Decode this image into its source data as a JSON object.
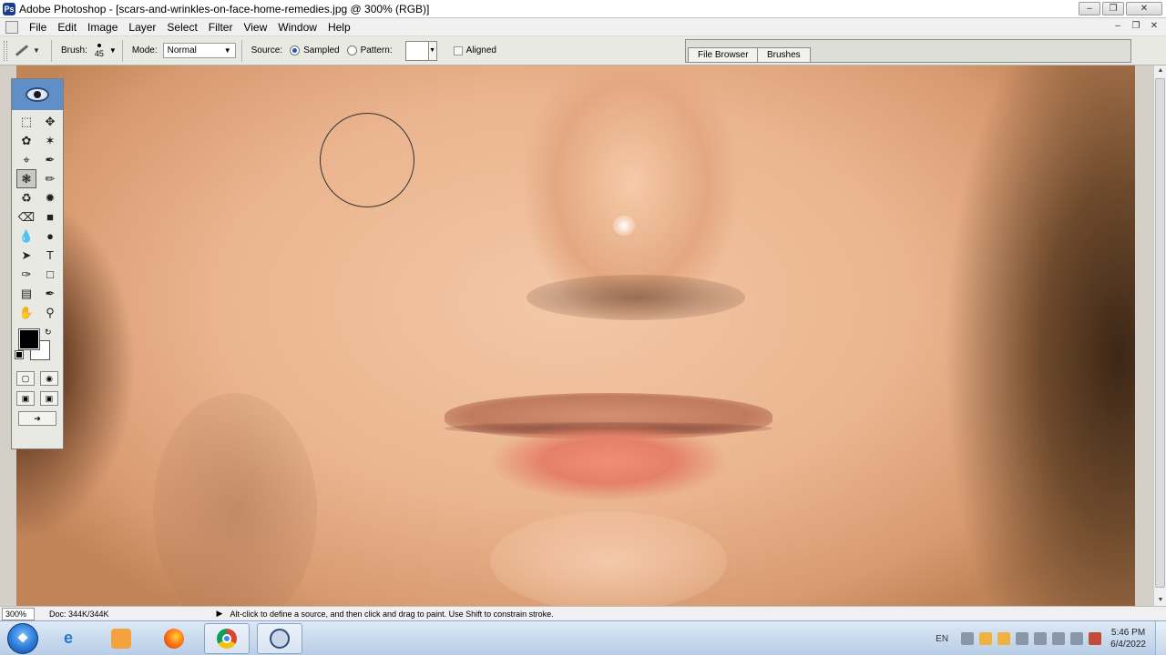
{
  "window": {
    "title": "Adobe Photoshop - [scars-and-wrinkles-on-face-home-remedies.jpg @ 300% (RGB)]"
  },
  "menu": [
    "File",
    "Edit",
    "Image",
    "Layer",
    "Select",
    "Filter",
    "View",
    "Window",
    "Help"
  ],
  "options_bar": {
    "brush_label": "Brush:",
    "brush_size": "45",
    "mode_label": "Mode:",
    "mode_value": "Normal",
    "source_label": "Source:",
    "sampled_label": "Sampled",
    "pattern_label": "Pattern:",
    "aligned_label": "Aligned",
    "source_selected": "sampled"
  },
  "palette_well": {
    "tabs": [
      "File Browser",
      "Brushes"
    ]
  },
  "toolbox": {
    "foreground_color": "#000000",
    "background_color": "#ffffff",
    "active_tool": "healing-brush"
  },
  "status_bar": {
    "zoom": "300%",
    "doc_size": "Doc: 344K/344K",
    "hint": "Alt-click to define a source, and then click and drag to paint. Use Shift to constrain stroke."
  },
  "taskbar": {
    "apps": [
      "windows-start",
      "internet-explorer",
      "media-player",
      "firefox",
      "chrome",
      "photoshop"
    ],
    "active_app": "photoshop",
    "language": "EN",
    "time": "5:46 PM",
    "date": "6/4/2022"
  }
}
